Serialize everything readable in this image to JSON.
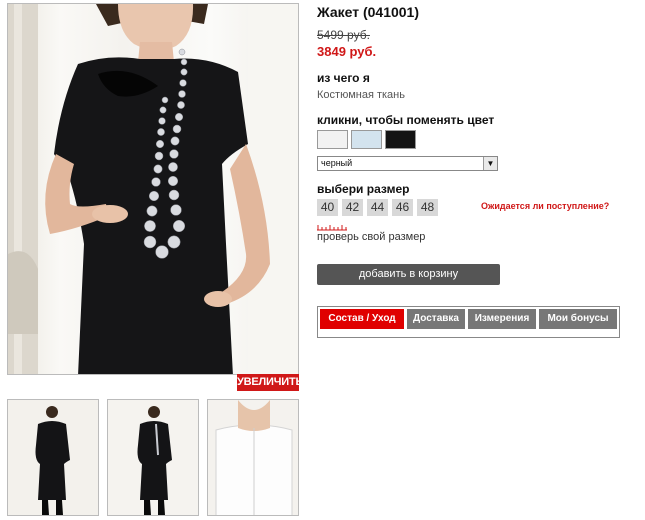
{
  "product": {
    "title": "Жакет (041001)",
    "old_price": "5499 руб.",
    "new_price": "3849 руб."
  },
  "gallery": {
    "zoom_label": "УВЕЛИЧИТЬ",
    "thumbnails": 3
  },
  "material": {
    "heading": "из чего я",
    "value": "Костюмная ткань"
  },
  "color": {
    "heading": "кликни, чтобы поменять цвет",
    "swatches": [
      "#f2f2f2",
      "#d3e3ee",
      "#141414"
    ],
    "selected": "черный"
  },
  "size": {
    "heading": "выбери размер",
    "options": [
      "40",
      "42",
      "44",
      "46",
      "48"
    ],
    "availability_link": "Ожидается ли поступление?",
    "check_link": "проверь свой размер"
  },
  "cart": {
    "button_label": "добавить в корзину"
  },
  "tabs": [
    {
      "label": "Состав / Уход",
      "active": true
    },
    {
      "label": "Доставка",
      "active": false
    },
    {
      "label": "Измерения",
      "active": false
    },
    {
      "label": "Мои бонусы",
      "active": false
    }
  ],
  "colors": {
    "accent_red": "#d01818",
    "tab_gray": "#777777",
    "button_gray": "#555555"
  }
}
